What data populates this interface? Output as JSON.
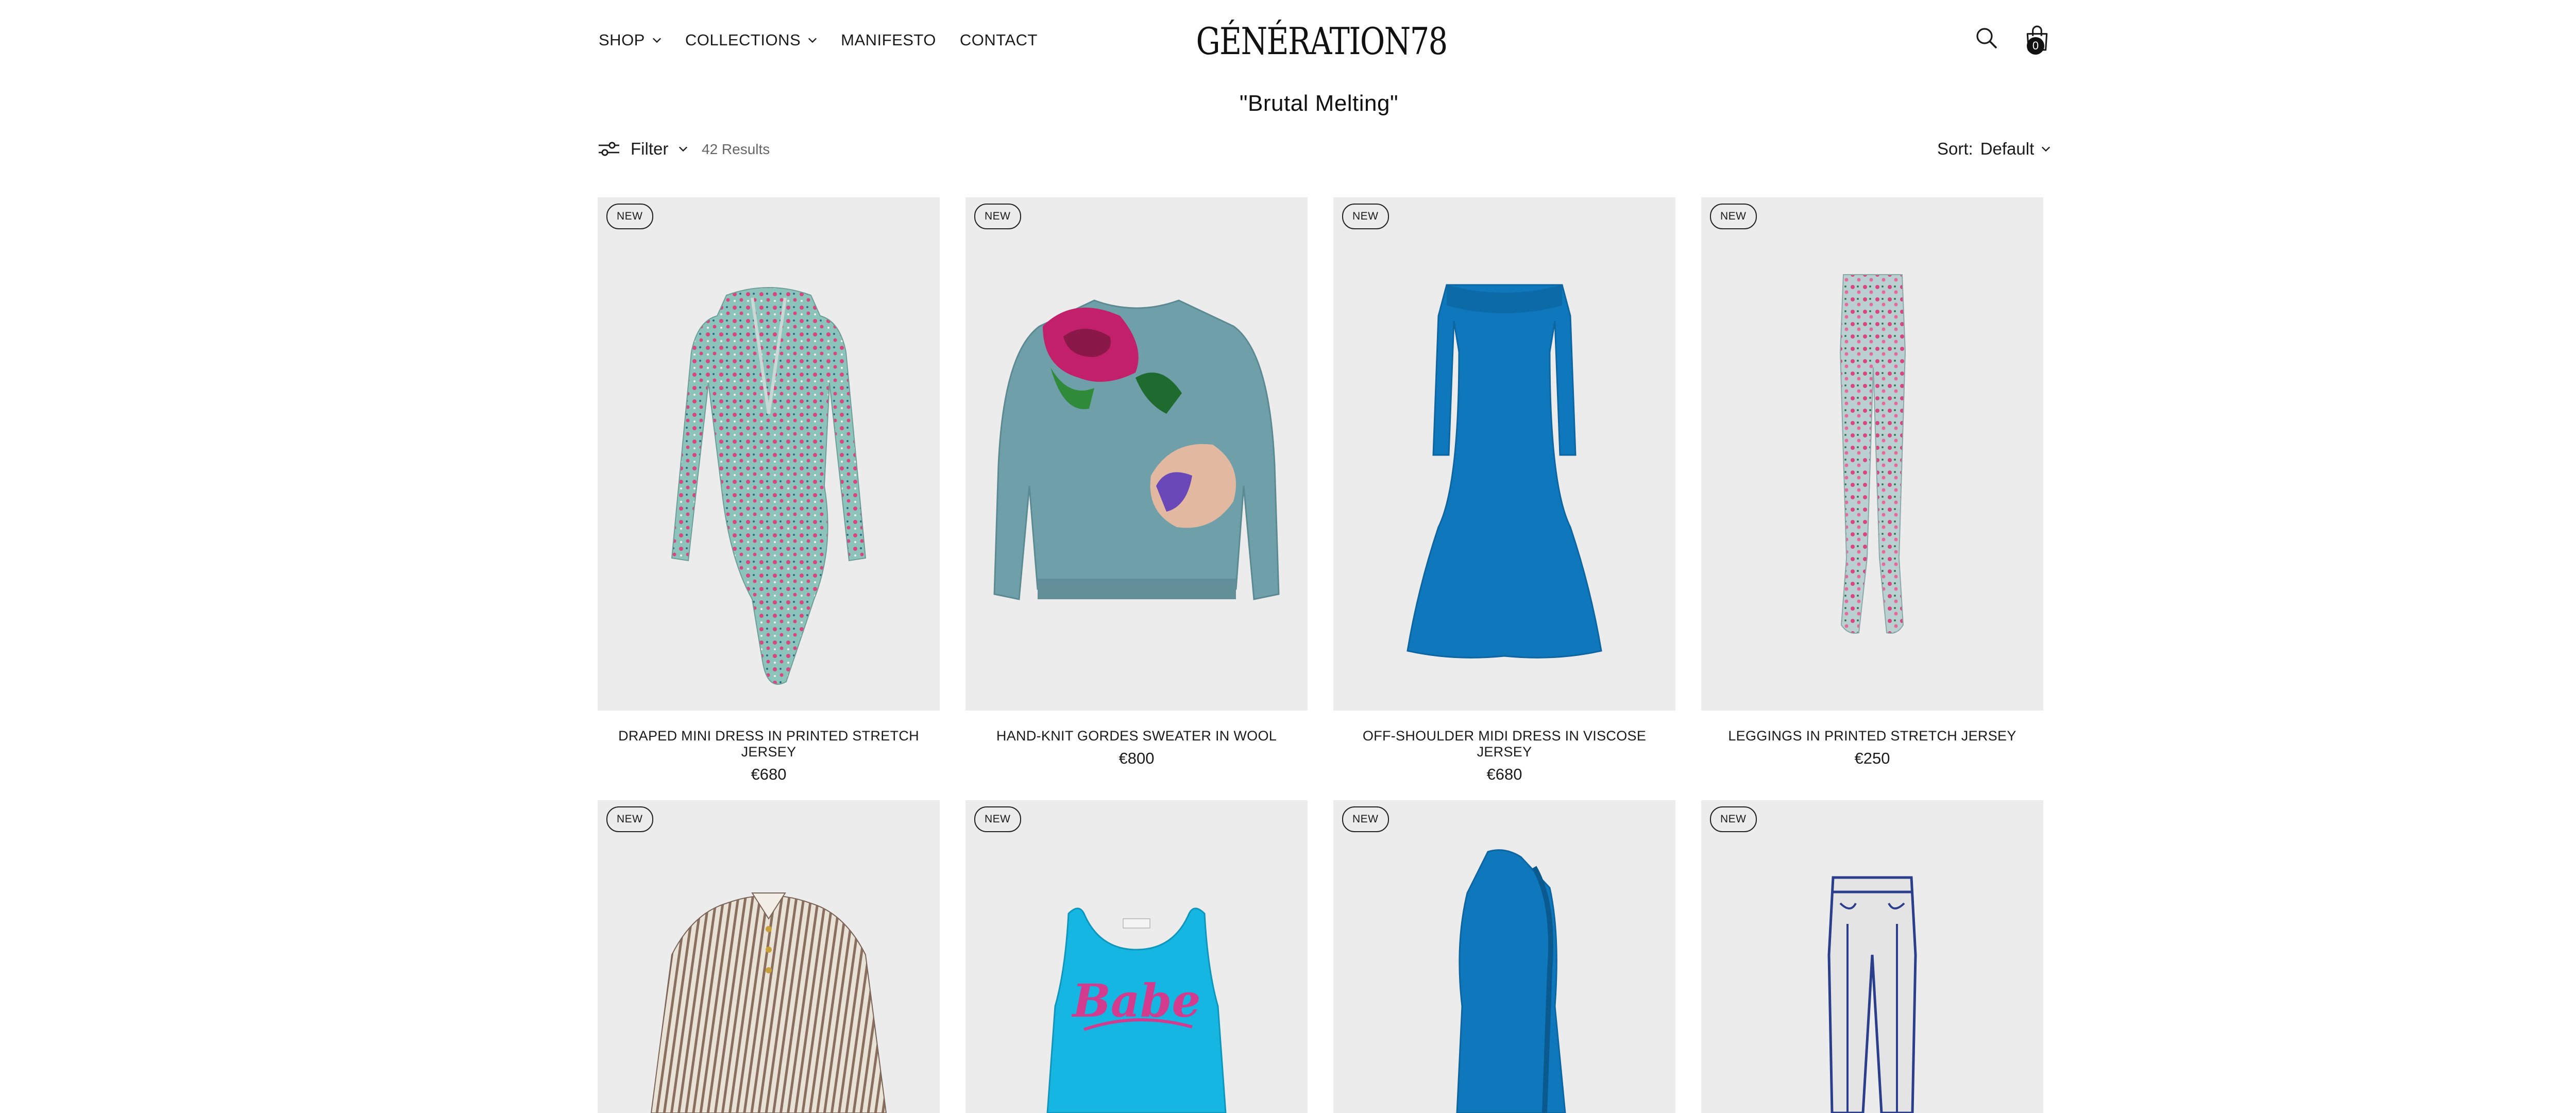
{
  "header": {
    "nav": [
      {
        "label": "SHOP",
        "dropdown": true
      },
      {
        "label": "COLLECTIONS",
        "dropdown": true
      },
      {
        "label": "MANIFESTO",
        "dropdown": false
      },
      {
        "label": "CONTACT",
        "dropdown": false
      }
    ],
    "logo_text": "GÉNÉRATION78",
    "cart_count": "0",
    "icons": [
      "search-icon",
      "bag-icon"
    ]
  },
  "page": {
    "title": "\"Brutal Melting\""
  },
  "toolbar": {
    "filter_label": "Filter",
    "results_label": "42 Results",
    "sort_label": "Sort:",
    "sort_value": "Default"
  },
  "products": [
    {
      "badge": "NEW",
      "name": "DRAPED MINI DRESS IN PRINTED STRETCH JERSEY",
      "price": "€680"
    },
    {
      "badge": "NEW",
      "name": "HAND-KNIT GORDES SWEATER IN WOOL",
      "price": "€800"
    },
    {
      "badge": "NEW",
      "name": "OFF-SHOULDER MIDI DRESS IN VISCOSE JERSEY",
      "price": "€680"
    },
    {
      "badge": "NEW",
      "name": "LEGGINGS IN PRINTED STRETCH JERSEY",
      "price": "€250"
    },
    {
      "badge": "NEW",
      "name": "",
      "price": ""
    },
    {
      "badge": "NEW",
      "name": "",
      "price": "",
      "print_text": "Babe"
    },
    {
      "badge": "NEW",
      "name": "",
      "price": ""
    },
    {
      "badge": "NEW",
      "name": "",
      "price": ""
    }
  ],
  "colors": {
    "text": "#1a1a1a",
    "tile_bg": "#ececec",
    "dress_print": "#7fb7b0",
    "knit_blue": "#6f9fa8",
    "viscose_blue": "#0f78bd",
    "tank_cyan": "#16b6e2",
    "babe_pink": "#d23b8e"
  }
}
